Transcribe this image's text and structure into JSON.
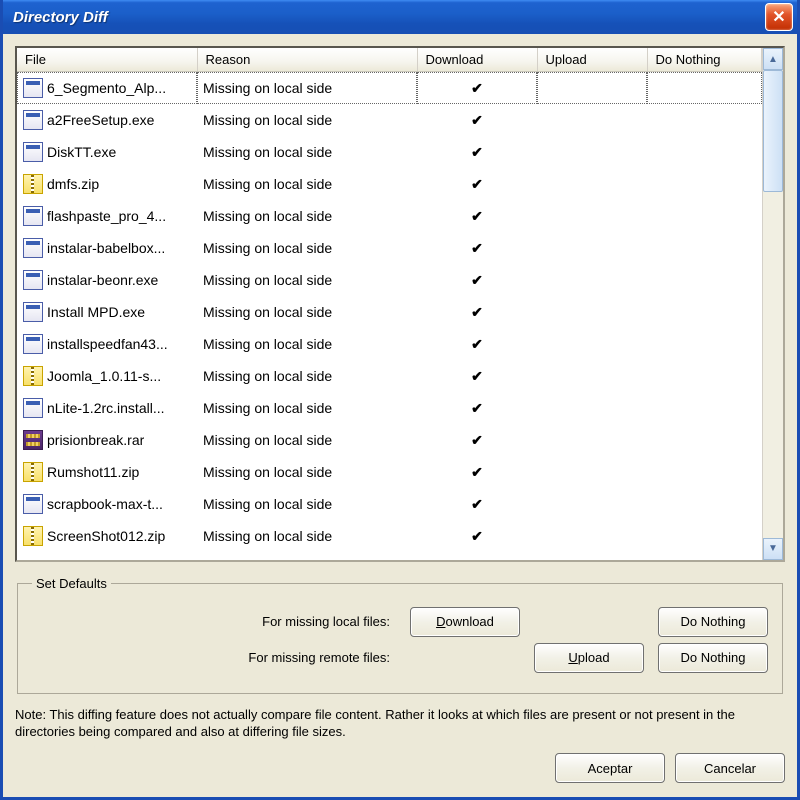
{
  "title": "Directory Diff",
  "columns": {
    "file": "File",
    "reason": "Reason",
    "download": "Download",
    "upload": "Upload",
    "donothing": "Do Nothing"
  },
  "rows": [
    {
      "file": "6_Segmento_Alp...",
      "icon": "exe",
      "reason": "Missing on local side",
      "download": true
    },
    {
      "file": "a2FreeSetup.exe",
      "icon": "exe",
      "reason": "Missing on local side",
      "download": true
    },
    {
      "file": "DiskTT.exe",
      "icon": "exe",
      "reason": "Missing on local side",
      "download": true
    },
    {
      "file": "dmfs.zip",
      "icon": "zip",
      "reason": "Missing on local side",
      "download": true
    },
    {
      "file": "flashpaste_pro_4...",
      "icon": "exe",
      "reason": "Missing on local side",
      "download": true
    },
    {
      "file": "instalar-babelbox...",
      "icon": "exe",
      "reason": "Missing on local side",
      "download": true
    },
    {
      "file": "instalar-beonr.exe",
      "icon": "exe",
      "reason": "Missing on local side",
      "download": true
    },
    {
      "file": "Install MPD.exe",
      "icon": "exe",
      "reason": "Missing on local side",
      "download": true
    },
    {
      "file": "installspeedfan43...",
      "icon": "exe",
      "reason": "Missing on local side",
      "download": true
    },
    {
      "file": "Joomla_1.0.11-s...",
      "icon": "zip",
      "reason": "Missing on local side",
      "download": true
    },
    {
      "file": "nLite-1.2rc.install...",
      "icon": "exe",
      "reason": "Missing on local side",
      "download": true
    },
    {
      "file": "prisionbreak.rar",
      "icon": "rar",
      "reason": "Missing on local side",
      "download": true
    },
    {
      "file": "Rumshot11.zip",
      "icon": "zip",
      "reason": "Missing on local side",
      "download": true
    },
    {
      "file": "scrapbook-max-t...",
      "icon": "exe",
      "reason": "Missing on local side",
      "download": true
    },
    {
      "file": "ScreenShot012.zip",
      "icon": "zip",
      "reason": "Missing on local side",
      "download": true
    }
  ],
  "defaults": {
    "legend": "Set Defaults",
    "local_label": "For missing local files:",
    "remote_label": "For missing remote files:",
    "download_btn": "Download",
    "upload_btn": "Upload",
    "donothing_btn": "Do Nothing"
  },
  "note": "Note: This diffing feature does not actually compare file content. Rather it looks at which files are present or not present in the directories being compared and also at differing file sizes.",
  "buttons": {
    "accept": "Aceptar",
    "cancel": "Cancelar"
  },
  "checkmark": "✔"
}
